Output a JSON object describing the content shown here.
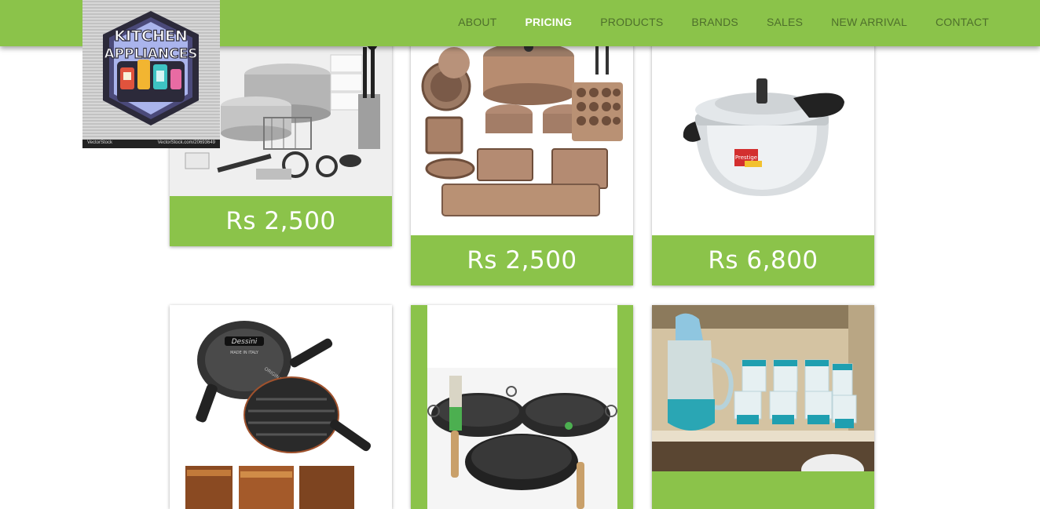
{
  "logo": {
    "line1": "KITCHEN",
    "line2": "APPLIANCES",
    "watermark_left": "VectorStock",
    "watermark_right": "VectorStock.com/20693649"
  },
  "nav": {
    "items": [
      {
        "label": "ABOUT",
        "active": false
      },
      {
        "label": "PRICING",
        "active": true
      },
      {
        "label": "PRODUCTS",
        "active": false
      },
      {
        "label": "BRANDS",
        "active": false
      },
      {
        "label": "SALES",
        "active": false
      },
      {
        "label": "NEW ARRIVAL",
        "active": false
      },
      {
        "label": "CONTACT",
        "active": false
      }
    ]
  },
  "products": [
    {
      "price": "Rs 2,500",
      "image": "stainless-cookware-set"
    },
    {
      "price": "Rs 2,500",
      "image": "copper-cookware-bakeware-set"
    },
    {
      "price": "Rs 6,800",
      "image": "pressure-cooker"
    },
    {
      "image": "double-grill-pan"
    },
    {
      "image": "wok-set"
    },
    {
      "image": "glass-jug-and-glasses"
    }
  ],
  "product_brands": {
    "cooker_label": "Prestige",
    "grill_label_top": "Dessini",
    "grill_label_sub": "MADE IN ITALY",
    "grill_label_side": "ORIGINAL"
  },
  "colors": {
    "accent": "#8bc34a",
    "nav_text": "#4e6f2b",
    "nav_active": "#ffffff"
  }
}
